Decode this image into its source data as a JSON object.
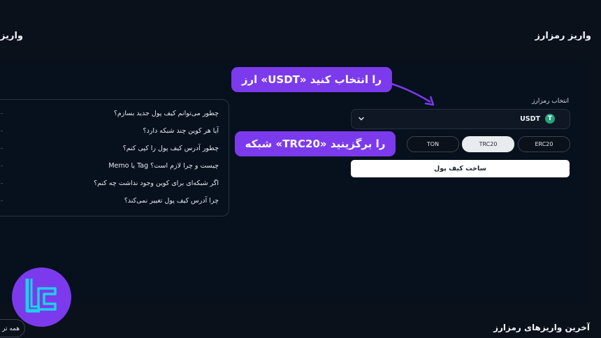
{
  "header": {
    "title": "واریز رمزارز",
    "title_left": "واریز"
  },
  "faq": {
    "items": [
      "چطور می‌توانم کیف پول جدید بسازم؟",
      "آیا هر کوین چند شبکه دارد؟",
      "چطور آدرس کیف پول را کپی کنم؟",
      "Memo یا Tag چیست و چرا لازم است؟",
      "اگر شبکه‌ای برای کوین وجود نداشت چه کنم؟",
      "چرا آدرس کیف پول تغییر نمی‌کند؟"
    ]
  },
  "form": {
    "coin_label": "انتخاب رمزارز",
    "coin_value": "USDT",
    "coin_icon": "tether-icon",
    "coin_icon_glyph": "T",
    "networks": [
      {
        "label": "ERC20",
        "selected": false
      },
      {
        "label": "TRC20",
        "selected": true
      },
      {
        "label": "TON",
        "selected": false
      }
    ],
    "create_wallet_label": "ساخت کیف پول"
  },
  "callouts": {
    "select_coin": "ارز «USDT» را انتخاب کنید",
    "select_network": "شبکه «TRC20» را برگزینید"
  },
  "recent": {
    "title": "آخرین واریزهای رمزارز",
    "see_all_label": "همه تر"
  },
  "colors": {
    "accent": "#7c3aed",
    "background": "#0b111a",
    "tether": "#26a17b"
  }
}
